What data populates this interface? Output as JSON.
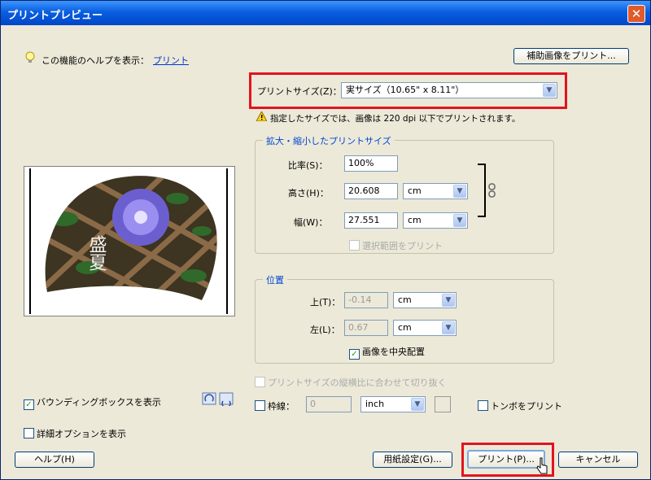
{
  "window": {
    "title": "プリントプレビュー",
    "close": "✕"
  },
  "help": {
    "text": "この機能のヘルプを表示：",
    "link": "プリント"
  },
  "buttons": {
    "print_extra": "補助画像をプリント...",
    "help": "ヘルプ(H)",
    "page_setup": "用紙設定(G)...",
    "print": "プリント(P)...",
    "cancel": "キャンセル"
  },
  "print_size": {
    "label": "プリントサイズ(Z)：",
    "value": "実サイズ（10.65\" x 8.11\"）",
    "warning": "指定したサイズでは、画像は 220 dpi 以下でプリントされます。"
  },
  "scaled": {
    "legend": "拡大・縮小したプリントサイズ",
    "scale_label": "比率(S)：",
    "scale_value": "100%",
    "height_label": "高さ(H)：",
    "height_value": "20.608",
    "height_unit": "cm",
    "width_label": "幅(W)：",
    "width_value": "27.551",
    "width_unit": "cm",
    "print_selection": "選択範囲をプリント"
  },
  "position": {
    "legend": "位置",
    "top_label": "上(T)：",
    "top_value": "-0.14",
    "top_unit": "cm",
    "left_label": "左(L)：",
    "left_value": "0.67",
    "left_unit": "cm",
    "center_image": "画像を中央配置"
  },
  "options": {
    "fit_crop": "プリントサイズの縦横比に合わせて切り抜く",
    "border_label": "枠線：",
    "border_value": "0",
    "border_unit": "inch",
    "crop_marks": "トンボをプリント",
    "bounding_box": "バウンディングボックスを表示",
    "more_options": "詳細オプションを表示"
  },
  "preview": {
    "text": "盛夏"
  },
  "colors": {
    "accent": "#0046d5",
    "highlight": "#e1141e"
  }
}
